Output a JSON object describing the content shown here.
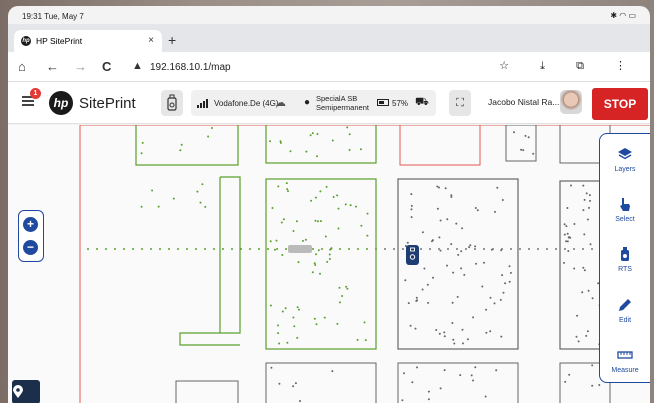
{
  "status_bar": {
    "time": "19:31 Tue, May 7",
    "icons": "✱ ◠ ▭"
  },
  "browser": {
    "tab_title": "HP SitePrint",
    "tab_close": "×",
    "new_tab": "+",
    "url": "192.168.10.1/map",
    "back": "←",
    "forward": "→",
    "reload": "C",
    "home": "⌂",
    "right_icons": "☆ ⤓ ⧉ ⋮"
  },
  "app": {
    "menu_badge": "1",
    "logo_text": "hp",
    "name": "SitePrint",
    "connection": "Vodafone.De (4G)",
    "paint_line1": "SpecialA SB",
    "paint_line2": "Semipermanent",
    "battery": "57%",
    "user_name": "Jacobo Nistal Ra...",
    "stop_label": "STOP",
    "accent_color": "#1f4aa0",
    "stop_color": "#d62323"
  },
  "map": {
    "zoom_in": "+",
    "zoom_out": "−",
    "locate_icon": "location-pin"
  },
  "side_panel": {
    "items": [
      {
        "label": "Layers",
        "icon": "layers-icon"
      },
      {
        "label": "Select",
        "icon": "hand-pointer-icon"
      },
      {
        "label": "RTS",
        "icon": "robot-icon"
      },
      {
        "label": "Edit",
        "icon": "pencil-icon"
      },
      {
        "label": "Measure",
        "icon": "ruler-icon"
      }
    ]
  }
}
